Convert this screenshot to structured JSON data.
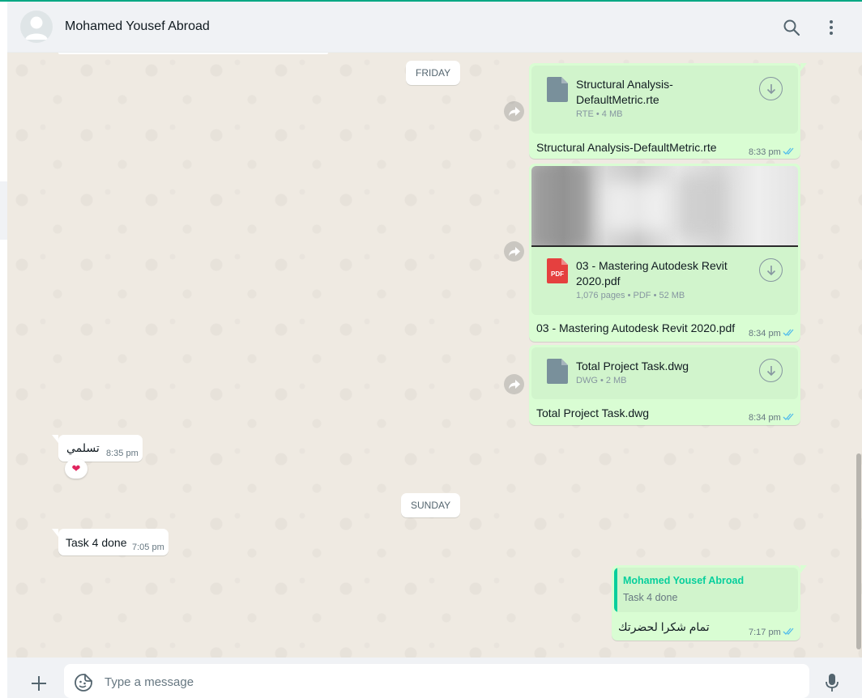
{
  "header": {
    "contact_name": "Mohamed Yousef Abroad",
    "icons": [
      "search-icon",
      "menu-icon"
    ]
  },
  "chat": {
    "date_friday": "FRIDAY",
    "date_sunday": "SUNDAY",
    "messages": [
      {
        "direction": "outgoing",
        "type": "document",
        "file_name": "Structural Analysis-DefaultMetric.rte",
        "file_meta": "RTE • 4 MB",
        "caption": "Structural Analysis-DefaultMetric.rte",
        "time": "8:33 pm",
        "status": "read"
      },
      {
        "direction": "outgoing",
        "type": "document",
        "file_name": "03 - Mastering Autodesk Revit 2020.pdf",
        "file_badge": "PDF",
        "file_meta": "1,076 pages • PDF • 52 MB",
        "caption": "03 - Mastering Autodesk Revit 2020.pdf",
        "time": "8:34 pm",
        "status": "read"
      },
      {
        "direction": "outgoing",
        "type": "document",
        "file_name": "Total Project Task.dwg",
        "file_meta": "DWG • 2 MB",
        "caption": "Total Project Task.dwg",
        "time": "8:34 pm",
        "status": "read"
      },
      {
        "direction": "incoming",
        "type": "text",
        "text": "تسلمي",
        "time": "8:35 pm",
        "reaction": "❤"
      },
      {
        "direction": "incoming",
        "type": "text",
        "text": "Task 4 done",
        "time": "7:05 pm"
      },
      {
        "direction": "outgoing",
        "type": "reply",
        "quoted_name": "Mohamed Yousef Abroad",
        "quoted_text": "Task 4 done",
        "text": "تمام شكرا لحضرتك",
        "time": "7:17 pm",
        "status": "read"
      }
    ]
  },
  "composer": {
    "placeholder": "Type a message",
    "value": "",
    "icons": [
      "plus-icon",
      "sticker-icon",
      "mic-icon"
    ]
  },
  "colors": {
    "accent": "#00a884",
    "outgoing_bubble": "#d9fdd3",
    "incoming_bubble": "#ffffff",
    "chat_background": "#efeae2",
    "read_ticks": "#53bdeb",
    "pdf_red": "#e5403f"
  }
}
